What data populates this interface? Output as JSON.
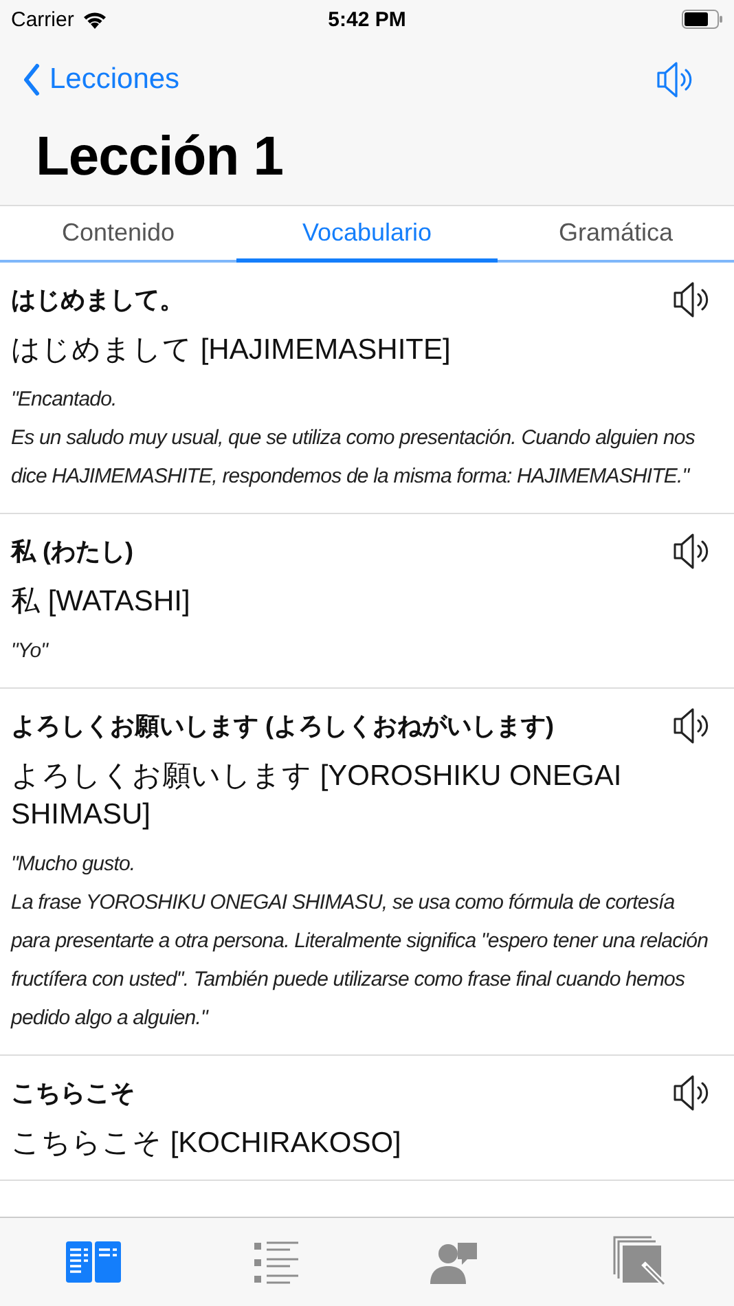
{
  "status_bar": {
    "carrier": "Carrier",
    "time": "5:42 PM"
  },
  "nav": {
    "back": "Lecciones",
    "title": "Lección 1"
  },
  "tabs": [
    {
      "label": "Contenido",
      "selected": false
    },
    {
      "label": "Vocabulario",
      "selected": true
    },
    {
      "label": "Gramática",
      "selected": false
    }
  ],
  "entries": [
    {
      "title": "はじめまして。",
      "reading": "はじめまして [HAJIMEMASHITE]",
      "description": "\"Encantado.\nEs un saludo muy usual, que se utiliza como presentación. Cuando alguien nos dice HAJIMEMASHITE, respondemos de la misma forma: HAJIMEMASHITE.\""
    },
    {
      "title": "私 (わたし)",
      "reading": "私 [WATASHI]",
      "description": "\"Yo\""
    },
    {
      "title": "よろしくお願いします (よろしくおねがいします)",
      "reading": "よろしくお願いします [YOROSHIKU ONEGAI SHIMASU]",
      "description": "\"Mucho gusto.\nLa frase YOROSHIKU ONEGAI SHIMASU, se usa como fórmula de cortesía para presentarte a otra persona. Literalmente significa \"espero tener una relación fructífera con usted\". También puede utilizarse como frase final cuando hemos pedido algo a alguien.\""
    },
    {
      "title": "こちらこそ",
      "reading": "こちらこそ [KOCHIRAKOSO]"
    }
  ],
  "tab_bar": [
    {
      "kind": "book",
      "selected": true
    },
    {
      "kind": "list",
      "selected": false
    },
    {
      "kind": "people",
      "selected": false
    },
    {
      "kind": "pages",
      "selected": false
    }
  ]
}
